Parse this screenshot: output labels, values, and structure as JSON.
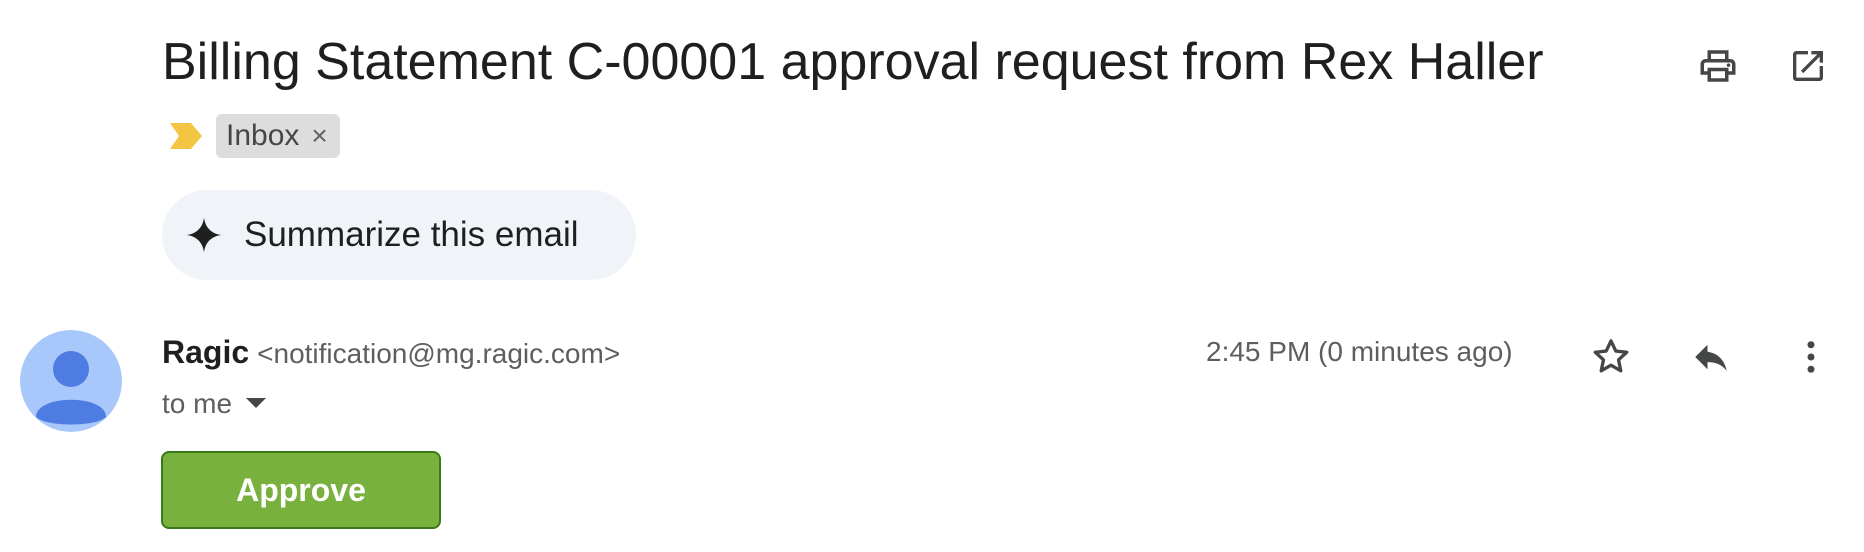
{
  "email": {
    "subject": "Billing Statement C-00001 approval request from Rex Haller",
    "labels": [
      {
        "name": "Inbox",
        "remove_symbol": "×"
      }
    ],
    "summarize_label": "Summarize this email",
    "sender": {
      "name": "Ragic",
      "email": "<notification@mg.ragic.com>"
    },
    "recipient_label": "to me",
    "timestamp": "2:45 PM (0 minutes ago)",
    "approve_label": "Approve"
  },
  "icons": {
    "print": "print-icon",
    "popout": "open-in-new-window-icon",
    "importance": "importance-marker-icon",
    "summarize": "sparkle-icon",
    "avatar": "default-avatar-icon",
    "caret": "caret-down-icon",
    "star": "star-icon",
    "reply": "reply-icon",
    "more": "more-vertical-icon"
  },
  "colors": {
    "importance_marker": "#f4c542",
    "approve_button": "#78b13d",
    "approve_border": "#3a7a1a",
    "summarize_bg": "#f0f4f9",
    "chip_bg": "#dddddd",
    "avatar_bg": "#a8c7fa",
    "avatar_figure": "#4e7ce3"
  }
}
